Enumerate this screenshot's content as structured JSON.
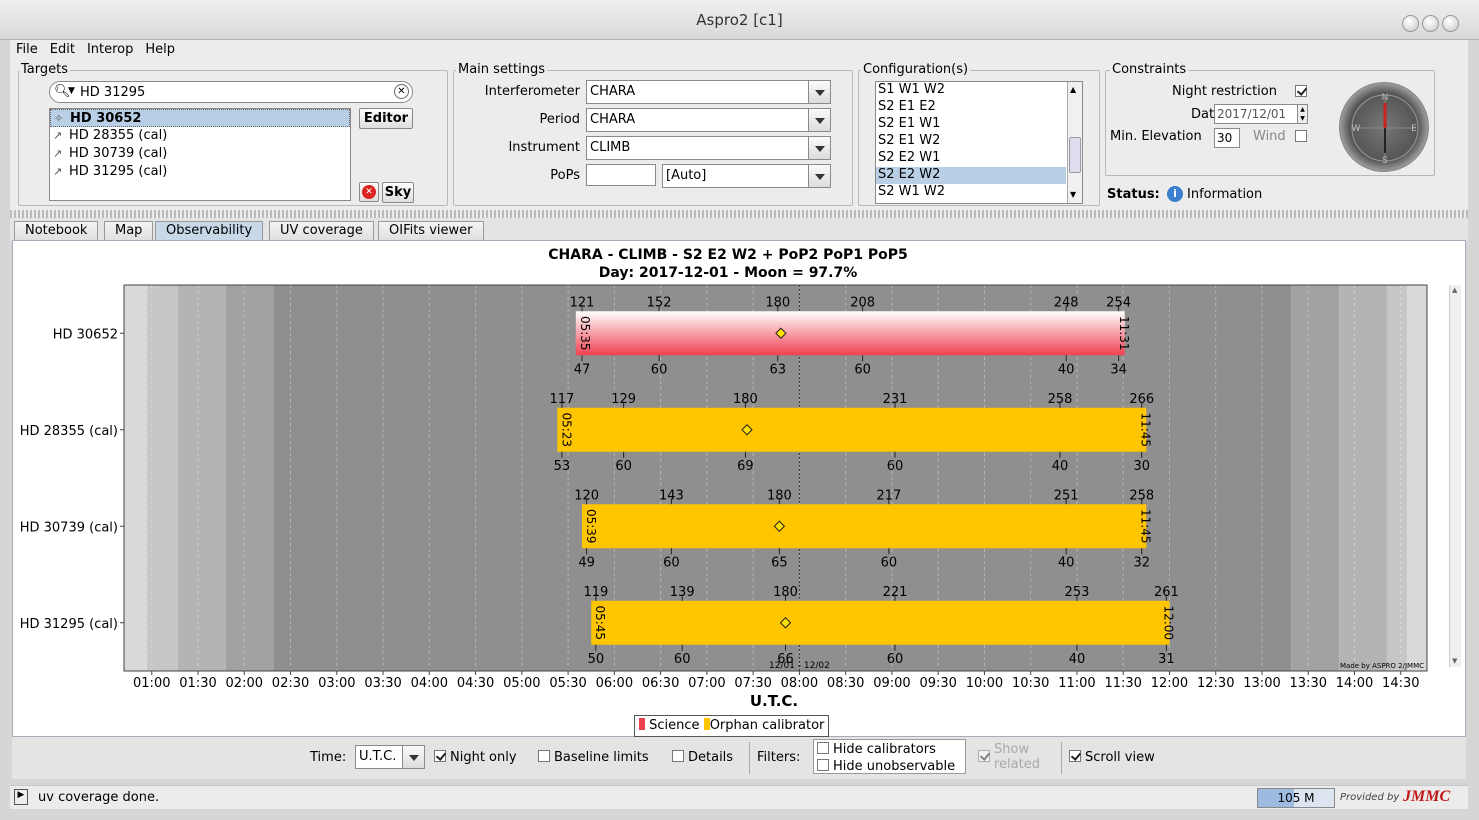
{
  "window": {
    "title": "Aspro2 [c1]"
  },
  "menu": [
    "File",
    "Edit",
    "Interop",
    "Help"
  ],
  "targets": {
    "title": "Targets",
    "search_value": "HD 31295",
    "items": [
      "HD 30652",
      "HD 28355 (cal)",
      "HD 30739 (cal)",
      "HD 31295 (cal)"
    ],
    "selected": 0,
    "editor_label": "Editor",
    "sky_label": "Sky"
  },
  "main_settings": {
    "title": "Main settings",
    "interferometer_label": "Interferometer",
    "interferometer_value": "CHARA",
    "period_label": "Period",
    "period_value": "CHARA",
    "instrument_label": "Instrument",
    "instrument_value": "CLIMB",
    "pops_label": "PoPs",
    "pops_value": "",
    "pops_combo": "[Auto]"
  },
  "configurations": {
    "title": "Configuration(s)",
    "items": [
      "S1 W1 W2",
      "S2 E1 E2",
      "S2 E1 W1",
      "S2 E1 W2",
      "S2 E2 W1",
      "S2 E2 W2",
      "S2 W1 W2"
    ],
    "selected": 5
  },
  "constraints": {
    "title": "Constraints",
    "night_label": "Night restriction",
    "night_checked": true,
    "date_label": "Date",
    "date_value": "2017/12/01",
    "min_elev_label": "Min. Elevation",
    "min_elev_value": "30",
    "wind_label": "Wind",
    "wind_checked": false,
    "status_label": "Status:",
    "status_value": "Information",
    "compass_letters": [
      "N",
      "E",
      "S",
      "W"
    ]
  },
  "tabs": [
    "Notebook",
    "Map",
    "Observability",
    "UV coverage",
    "OIFits viewer"
  ],
  "active_tab": 2,
  "chart_data": {
    "type": "gantt",
    "title": "CHARA - CLIMB - S2 E2 W2 + PoP2 PoP1 PoP5",
    "subtitle": "Day: 2017-12-01 - Moon = 97.7%",
    "xlabel": "U.T.C.",
    "x_ticks": [
      "01:00",
      "01:30",
      "02:00",
      "02:30",
      "03:00",
      "03:30",
      "04:00",
      "04:30",
      "05:00",
      "05:30",
      "06:00",
      "06:30",
      "07:00",
      "07:30",
      "08:00",
      "08:30",
      "09:00",
      "09:30",
      "10:00",
      "10:30",
      "11:00",
      "11:30",
      "12:00",
      "12:30",
      "13:00",
      "13:30",
      "14:00",
      "14:30"
    ],
    "xlim": [
      "00:42",
      "14:47"
    ],
    "date_marker": {
      "time": "08:00",
      "label": "12/01 - 12/02"
    },
    "twilight_bands": [
      {
        "from": "00:42",
        "to": "00:57",
        "shade": "#d9d9d9"
      },
      {
        "from": "00:57",
        "to": "01:17",
        "shade": "#c6c6c6"
      },
      {
        "from": "01:17",
        "to": "01:48",
        "shade": "#b4b4b4"
      },
      {
        "from": "01:48",
        "to": "02:19",
        "shade": "#a2a2a2"
      },
      {
        "from": "02:19",
        "to": "13:19",
        "shade": "#8f8f8f"
      },
      {
        "from": "13:19",
        "to": "13:50",
        "shade": "#a2a2a2"
      },
      {
        "from": "13:50",
        "to": "14:21",
        "shade": "#b4b4b4"
      },
      {
        "from": "14:21",
        "to": "14:34",
        "shade": "#c6c6c6"
      },
      {
        "from": "14:34",
        "to": "14:47",
        "shade": "#d9d9d9"
      }
    ],
    "rows": [
      {
        "name": "HD 30652",
        "kind": "Science",
        "start": "05:35",
        "end": "11:31",
        "start_label": "05:35",
        "end_label": "11:31",
        "transit": "07:48",
        "top_labels": [
          [
            "05:39",
            "121"
          ],
          [
            "06:29",
            "152"
          ],
          [
            "07:46",
            "180"
          ],
          [
            "08:41",
            "208"
          ],
          [
            "10:53",
            "248"
          ],
          [
            "11:27",
            "254"
          ]
        ],
        "bottom_labels": [
          [
            "05:39",
            "47"
          ],
          [
            "06:29",
            "60"
          ],
          [
            "07:46",
            "63"
          ],
          [
            "08:41",
            "60"
          ],
          [
            "10:53",
            "40"
          ],
          [
            "11:27",
            "34"
          ]
        ]
      },
      {
        "name": "HD 28355 (cal)",
        "kind": "Orphan calibrator",
        "start": "05:23",
        "end": "11:45",
        "start_label": "05:23",
        "end_label": "11:45",
        "transit": "07:26",
        "top_labels": [
          [
            "05:26",
            "117"
          ],
          [
            "06:06",
            "129"
          ],
          [
            "07:25",
            "180"
          ],
          [
            "09:02",
            "231"
          ],
          [
            "10:49",
            "258"
          ],
          [
            "11:42",
            "266"
          ]
        ],
        "bottom_labels": [
          [
            "05:26",
            "53"
          ],
          [
            "06:06",
            "60"
          ],
          [
            "07:25",
            "69"
          ],
          [
            "09:02",
            "60"
          ],
          [
            "10:49",
            "40"
          ],
          [
            "11:42",
            "30"
          ]
        ]
      },
      {
        "name": "HD 30739 (cal)",
        "kind": "Orphan calibrator",
        "start": "05:39",
        "end": "11:45",
        "start_label": "05:39",
        "end_label": "11:45",
        "transit": "07:47",
        "top_labels": [
          [
            "05:42",
            "120"
          ],
          [
            "06:37",
            "143"
          ],
          [
            "07:47",
            "180"
          ],
          [
            "08:58",
            "217"
          ],
          [
            "10:53",
            "251"
          ],
          [
            "11:42",
            "258"
          ]
        ],
        "bottom_labels": [
          [
            "05:42",
            "49"
          ],
          [
            "06:37",
            "60"
          ],
          [
            "07:47",
            "65"
          ],
          [
            "08:58",
            "60"
          ],
          [
            "10:53",
            "40"
          ],
          [
            "11:42",
            "32"
          ]
        ]
      },
      {
        "name": "HD 31295 (cal)",
        "kind": "Orphan calibrator",
        "start": "05:45",
        "end": "12:00",
        "start_label": "05:45",
        "end_label": "12:00",
        "transit": "07:51",
        "top_labels": [
          [
            "05:48",
            "119"
          ],
          [
            "06:44",
            "139"
          ],
          [
            "07:51",
            "180"
          ],
          [
            "09:02",
            "221"
          ],
          [
            "11:00",
            "253"
          ],
          [
            "11:58",
            "261"
          ]
        ],
        "bottom_labels": [
          [
            "05:48",
            "50"
          ],
          [
            "06:44",
            "60"
          ],
          [
            "07:51",
            "66"
          ],
          [
            "09:02",
            "60"
          ],
          [
            "11:00",
            "40"
          ],
          [
            "11:58",
            "31"
          ]
        ]
      }
    ],
    "legend": [
      "Science",
      "Orphan calibrator"
    ],
    "colors": {
      "Science": "#f04050",
      "Orphan calibrator": "#ffc600"
    },
    "credit": "Made by ASPRO 2/JMMC"
  },
  "bottom": {
    "time_label": "Time:",
    "time_value": "U.T.C.",
    "night_only": "Night only",
    "night_only_checked": true,
    "baseline_limits": "Baseline limits",
    "details": "Details",
    "filters_label": "Filters:",
    "hide_calibrators": "Hide calibrators",
    "hide_unobservable": "Hide unobservable",
    "show_related": "Show related",
    "scroll_view": "Scroll view",
    "scroll_view_checked": true
  },
  "status": {
    "message": "uv coverage done.",
    "memory": "105 M",
    "provided_by": "Provided by",
    "brand": "JMMC"
  }
}
